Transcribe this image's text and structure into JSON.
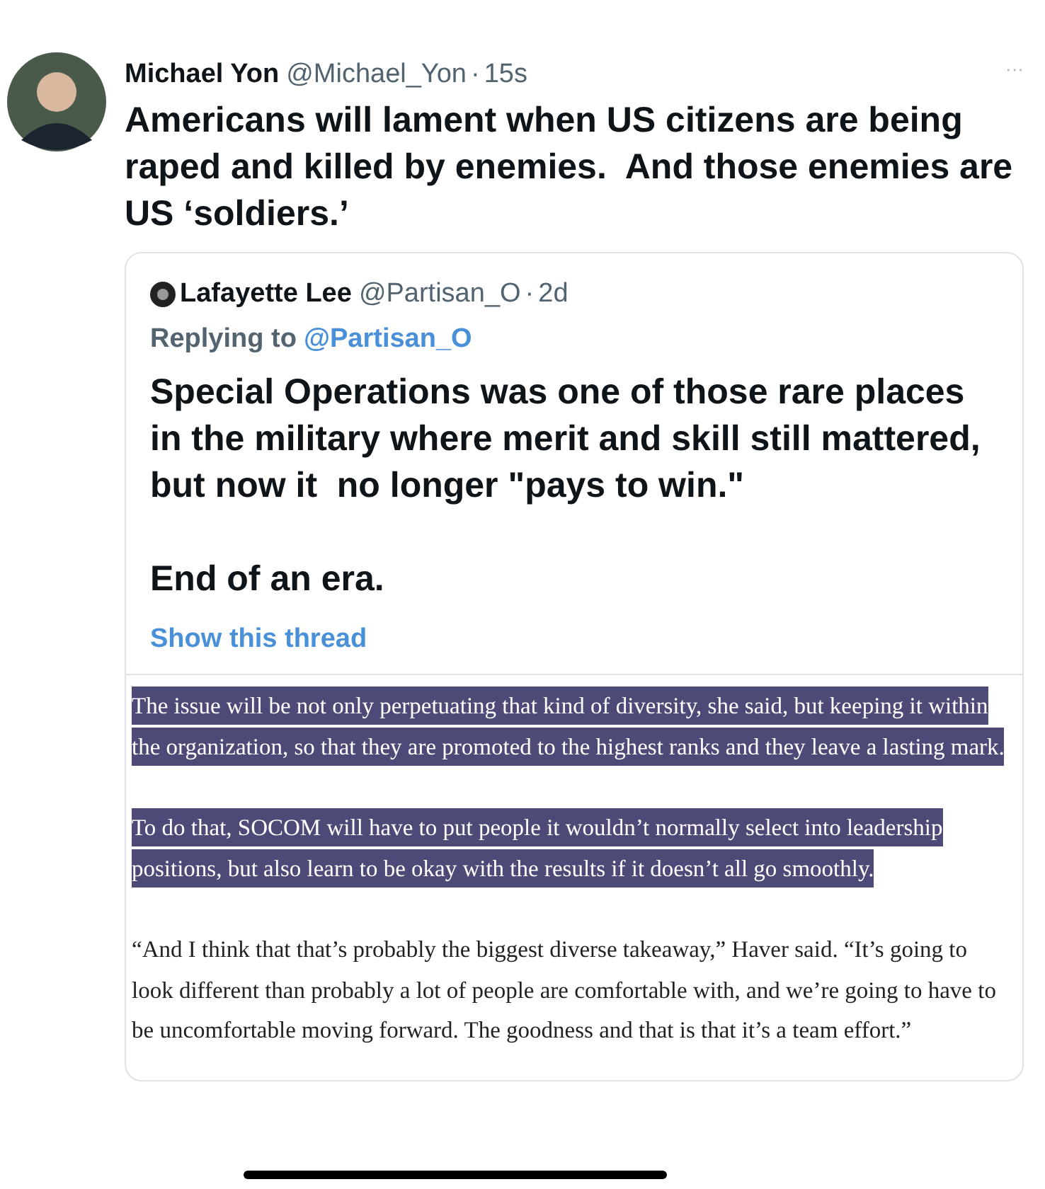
{
  "tweet": {
    "name": "Michael Yon",
    "handle": "@Michael_Yon",
    "separator": "·",
    "time": "15s",
    "more": "···",
    "text": "Americans will lament when US citizens are being raped and killed by enemies.  And those enemies are US ‘soldiers.’",
    "quote": {
      "name": "Lafayette Lee",
      "handle": "@Partisan_O",
      "separator": "·",
      "time": "2d",
      "replying_label": "Replying to",
      "replying_to": "@Partisan_O",
      "paragraphs": [
        "Special Operations was one of those rare places in the military where merit and skill still mattered, but now it  no longer \"pays to win.\"",
        "End of an era."
      ],
      "show_thread": "Show this thread",
      "article": [
        {
          "text": "The issue will be not only perpetuating that kind of diversity, she said, but keeping it within the organization, so that they are promoted to the highest ranks and they leave a lasting mark.",
          "highlighted": true
        },
        {
          "text": "To do that, SOCOM will have to put people it wouldn’t normally select into leadership positions, but also learn to be okay with the results if it doesn’t all go smoothly.",
          "highlighted": true
        },
        {
          "text": "“And I think that that’s probably the biggest diverse takeaway,” Haver said. “It’s going to look different than probably a lot of people are comfortable with, and we’re going to have to be uncomfortable moving forward. The goodness and that is that it’s a team effort.”",
          "highlighted": false
        }
      ]
    }
  }
}
